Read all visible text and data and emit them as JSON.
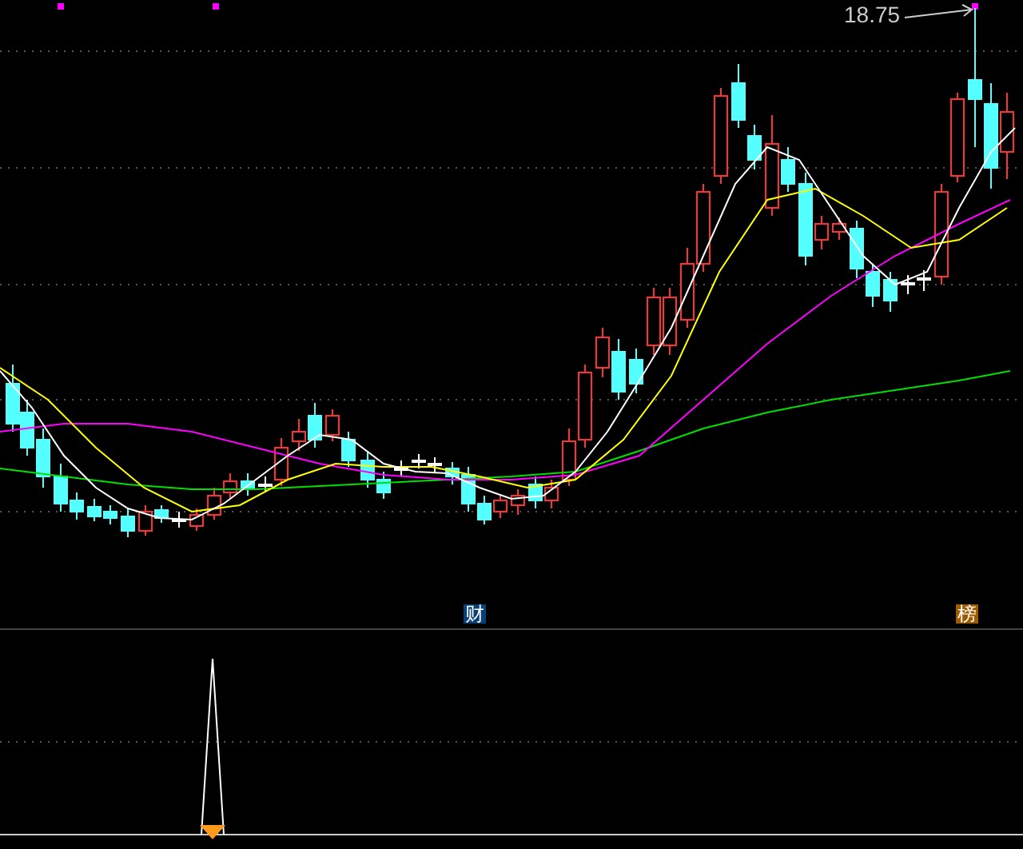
{
  "price_chart": {
    "high_label": "18.75",
    "markers": [
      {
        "text": "财",
        "color": "#0a3f78"
      },
      {
        "text": "榜",
        "color": "#a05a00"
      }
    ]
  }
}
